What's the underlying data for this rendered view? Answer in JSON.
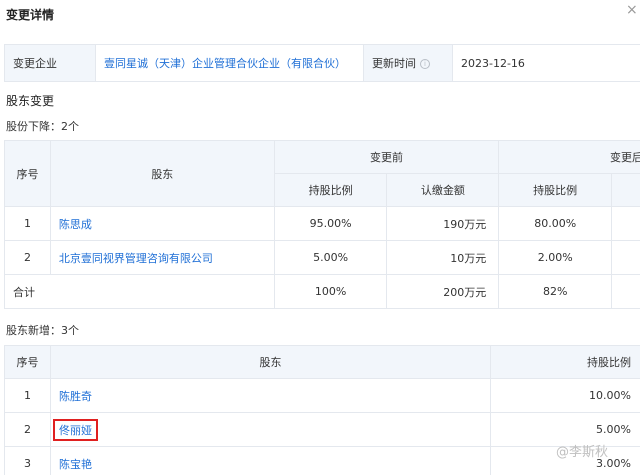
{
  "page": {
    "title": "变更详情",
    "close": "×"
  },
  "info": {
    "company_label": "变更企业",
    "company_name": "壹同星诚（天津）企业管理合伙企业（有限合伙）",
    "time_label": "更新时间",
    "time_help_icon": "info-circle-icon",
    "time_value": "2023-12-16"
  },
  "shareholder_change": {
    "title": "股东变更"
  },
  "decrease": {
    "title": "股份下降：2个",
    "headers": {
      "no": "序号",
      "holder": "股东",
      "before": "变更前",
      "after": "变更后",
      "ratio_before": "持股比例",
      "amount_before": "认缴金额",
      "ratio_after": "持股比例"
    },
    "rows": [
      {
        "no": "1",
        "name": "陈思成",
        "ratio_before": "95.00%",
        "amount_before": "190万元",
        "ratio_after": "80.00%"
      },
      {
        "no": "2",
        "name": "北京壹同视界管理咨询有限公司",
        "ratio_before": "5.00%",
        "amount_before": "10万元",
        "ratio_after": "2.00%"
      }
    ],
    "total": {
      "label": "合计",
      "ratio_before": "100%",
      "amount_before": "200万元",
      "ratio_after": "82%"
    }
  },
  "added": {
    "title": "股东新增：3个",
    "headers": {
      "no": "序号",
      "holder": "股东",
      "ratio": "持股比例"
    },
    "rows": [
      {
        "no": "1",
        "name": "陈胜奇",
        "ratio": "10.00%",
        "highlighted": false
      },
      {
        "no": "2",
        "name": "佟丽娅",
        "ratio": "5.00%",
        "highlighted": true
      },
      {
        "no": "3",
        "name": "陈宝艳",
        "ratio": "3.00%",
        "highlighted": false
      }
    ]
  },
  "watermark": "@李斯秋",
  "colors": {
    "link": "#1f6fd6",
    "header_bg": "#f2f6fb",
    "highlight": "#e02020"
  }
}
